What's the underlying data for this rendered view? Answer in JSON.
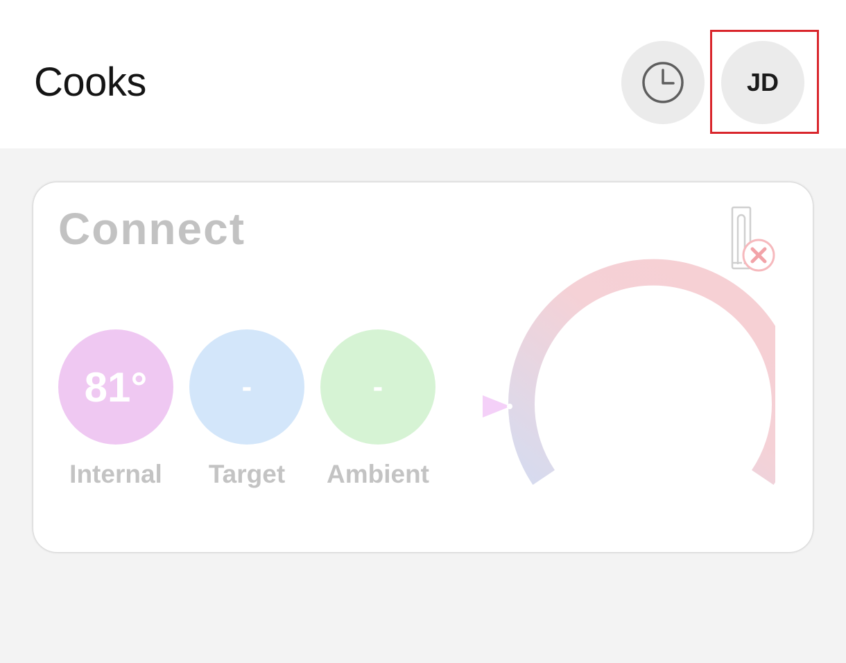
{
  "header": {
    "title": "Cooks",
    "history_icon": "clock-icon",
    "avatar_initials": "JD"
  },
  "card": {
    "title": "Connect",
    "status_icon": "probe-disconnected-icon",
    "readings": [
      {
        "value": "81°",
        "label": "Internal",
        "color": "#efc8f2"
      },
      {
        "value": "-",
        "label": "Target",
        "color": "#d3e6fa"
      },
      {
        "value": "-",
        "label": "Ambient",
        "color": "#d6f3d4"
      }
    ],
    "gauge_colors": {
      "start": "#d6dbef",
      "end": "#f6cfd3",
      "marker": "#f4d0f8"
    }
  },
  "colors": {
    "highlight": "#d9262c",
    "header_bg": "#ffffff",
    "page_bg": "#f3f3f3"
  }
}
